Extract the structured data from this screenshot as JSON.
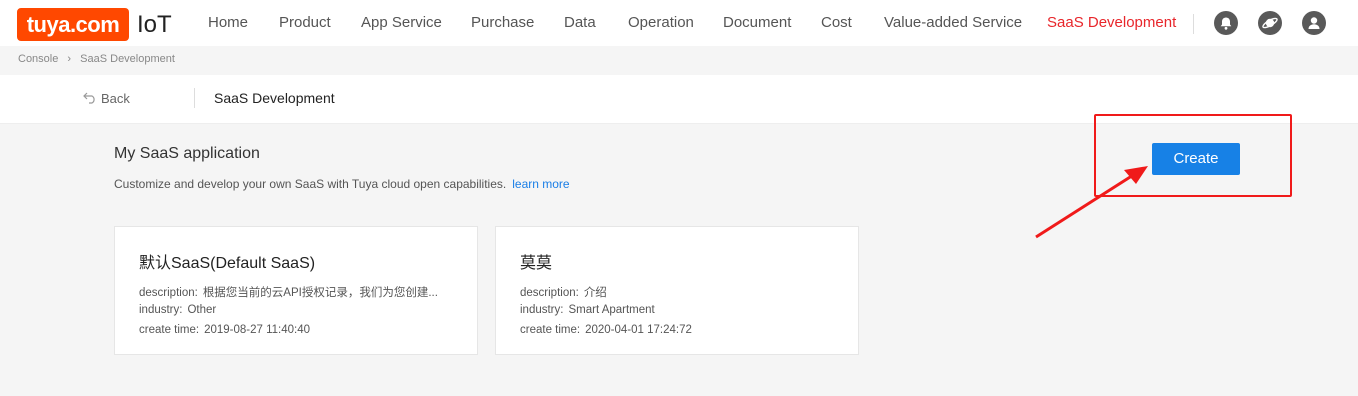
{
  "header": {
    "logo_text": "tuya.com",
    "product": "IoT",
    "nav": [
      {
        "label": "Home"
      },
      {
        "label": "Product"
      },
      {
        "label": "App Service"
      },
      {
        "label": "Purchase"
      },
      {
        "label": "Data"
      },
      {
        "label": "Operation"
      },
      {
        "label": "Document"
      },
      {
        "label": "Cost"
      },
      {
        "label": "Value-added Service"
      },
      {
        "label": "SaaS Development",
        "active": true
      }
    ],
    "icons": [
      "bell-icon",
      "planet-icon",
      "user-icon"
    ]
  },
  "breadcrumb": {
    "items": [
      "Console",
      "SaaS Development"
    ]
  },
  "subheader": {
    "back_label": "Back",
    "title": "SaaS Development"
  },
  "section": {
    "title": "My SaaS application",
    "description": "Customize and develop your own SaaS with Tuya cloud open capabilities.",
    "learn_more": "learn more",
    "create_label": "Create"
  },
  "cards": [
    {
      "title": "默认SaaS(Default SaaS)",
      "description_label": "description:",
      "description": "根据您当前的云API授权记录，我们为您创建...",
      "industry_label": "industry:",
      "industry": "Other",
      "create_time_label": "create time:",
      "create_time": "2019-08-27 11:40:40"
    },
    {
      "title": "莫莫",
      "description_label": "description:",
      "description": "介绍",
      "industry_label": "industry:",
      "industry": "Smart Apartment",
      "create_time_label": "create time:",
      "create_time": "2020-04-01 17:24:72"
    }
  ],
  "colors": {
    "accent": "#1781e6",
    "brand": "#ff4800",
    "nav_active": "#e8262b",
    "annotation": "#f01a1a"
  }
}
